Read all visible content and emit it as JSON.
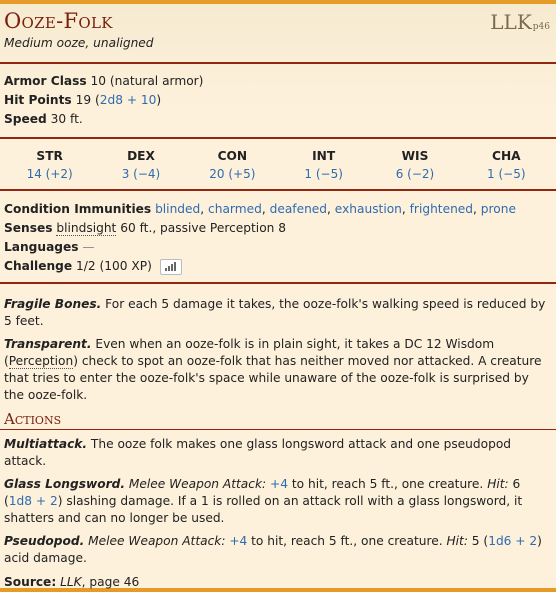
{
  "header": {
    "name": "Ooze-Folk",
    "meta": "Medium ooze, unaligned",
    "source_abbr": "LLK",
    "source_page": "p46"
  },
  "basics": {
    "ac_label": "Armor Class",
    "ac_value": "10 (natural armor)",
    "hp_label": "Hit Points",
    "hp_value": "19 (",
    "hp_dice": "2d8 + 10",
    "hp_close": ")",
    "speed_label": "Speed",
    "speed_value": "30 ft."
  },
  "abilities": [
    {
      "name": "STR",
      "value": "14 (+2)"
    },
    {
      "name": "DEX",
      "value": "3 (−4)"
    },
    {
      "name": "CON",
      "value": "20 (+5)"
    },
    {
      "name": "INT",
      "value": "1 (−5)"
    },
    {
      "name": "WIS",
      "value": "6 (−2)"
    },
    {
      "name": "CHA",
      "value": "1 (−5)"
    }
  ],
  "details": {
    "ci_label": "Condition Immunities",
    "conditions": [
      "blinded",
      "charmed",
      "deafened",
      "exhaustion",
      "frightened",
      "prone"
    ],
    "senses_label": "Senses",
    "senses_link": "blindsight",
    "senses_value": "60 ft., passive Perception 8",
    "languages_label": "Languages",
    "languages_value": "—",
    "challenge_label": "Challenge",
    "challenge_value": "1/2 (100 XP)",
    "chart_icon": "bar-chart-icon"
  },
  "traits": {
    "fragile_name": "Fragile Bones.",
    "fragile_text": "For each 5 damage it takes, the ooze-folk's walking speed is reduced by 5 feet.",
    "transparent_name": "Transparent.",
    "transparent_text_1": "Even when an ooze-folk is in plain sight, it takes a DC 12 Wisdom (",
    "transparent_link": "Perception",
    "transparent_text_2": ") check to spot an ooze-folk that has neither moved nor attacked. A creature that tries to enter the ooze-folk's space while unaware of the ooze-folk is surprised by the ooze-folk."
  },
  "actions": {
    "title": "Actions",
    "multi_name": "Multiattack.",
    "multi_text": "The ooze folk makes one glass longsword attack and one pseudopod attack.",
    "glass_name": "Glass Longsword.",
    "glass_type": "Melee Weapon Attack:",
    "glass_bonus": "+4",
    "glass_reach": "to hit, reach 5 ft., one creature.",
    "glass_hit": "Hit:",
    "glass_dmg": "6 (",
    "glass_dice": "1d8 + 2",
    "glass_rest": ") slashing damage. If a 1 is rolled on an attack roll with a glass longsword, it shatters and can no longer be used.",
    "pseudo_name": "Pseudopod.",
    "pseudo_type": "Melee Weapon Attack:",
    "pseudo_bonus": "+4",
    "pseudo_reach": "to hit, reach 5 ft., one creature.",
    "pseudo_hit": "Hit:",
    "pseudo_dmg": "5 (",
    "pseudo_dice": "1d6 + 2",
    "pseudo_rest": ") acid damage."
  },
  "footer": {
    "source_label": "Source:",
    "source_book": "LLK",
    "source_rest": ", page 46"
  },
  "colors": {
    "accent": "#e69a28",
    "title": "#7a200d",
    "link": "#2f6bb0",
    "background": "#fdf1dc"
  }
}
